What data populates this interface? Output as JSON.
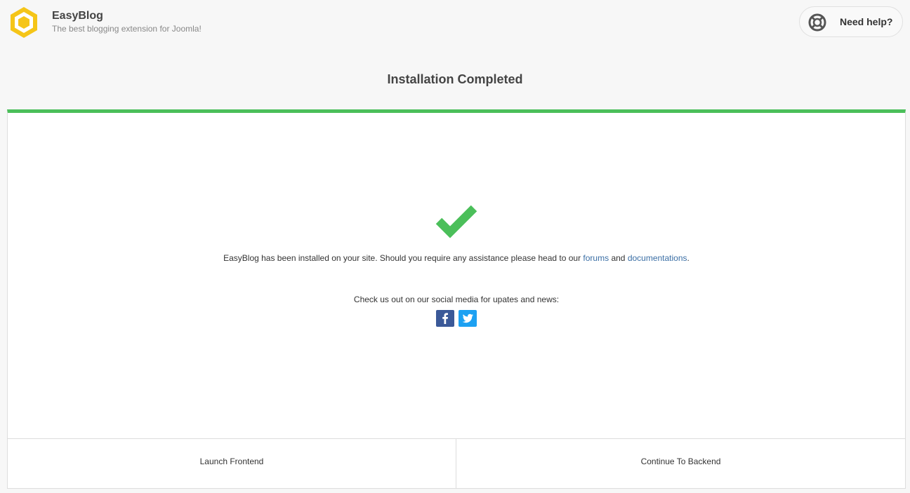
{
  "brand": {
    "name": "EasyBlog",
    "tagline": "The best blogging extension for Joomla!"
  },
  "help": {
    "label": "Need help?",
    "icon": "lifebuoy-icon"
  },
  "page": {
    "title": "Installation Completed"
  },
  "message": {
    "prefix": "EasyBlog has been installed on your site. Should you require any assistance please head to our ",
    "forums_link": "forums",
    "and_text": " and ",
    "docs_link": "documentations",
    "suffix": "."
  },
  "social": {
    "text": "Check us out on our social media for upates and news:",
    "facebook": {
      "icon": "facebook-icon",
      "color": "#3b5998"
    },
    "twitter": {
      "icon": "twitter-icon",
      "color": "#1da1f2"
    }
  },
  "actions": {
    "frontend": "Launch Frontend",
    "backend": "Continue To Backend"
  },
  "colors": {
    "accent_green": "#4bbf5a",
    "logo_yellow": "#f5c518",
    "link_blue": "#3a6ea5"
  }
}
